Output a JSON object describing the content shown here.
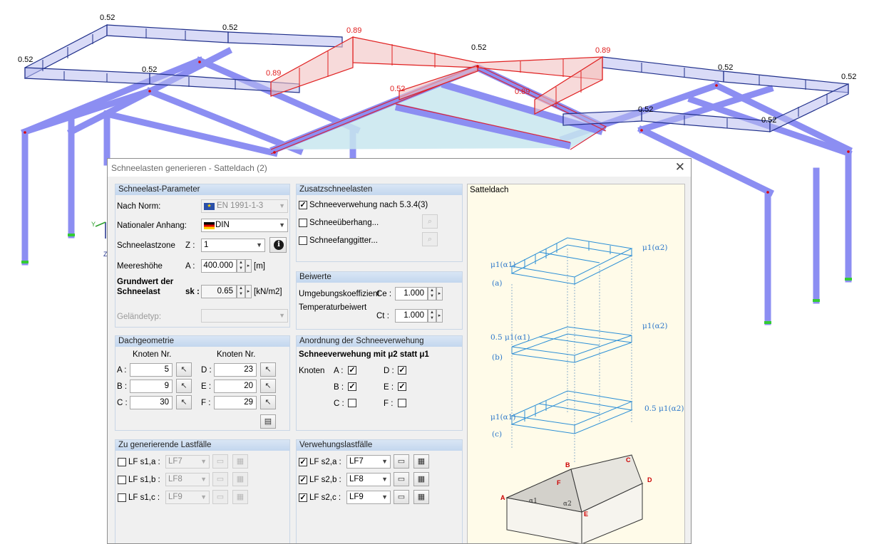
{
  "colors": {
    "member": "#8c8ef2",
    "load": "#1f2f8a",
    "drift_load": "#e02020",
    "diagram_blue": "#2b8fd6",
    "node_red": "#dd0000"
  },
  "structure": {
    "load_labels": [
      "0.52",
      "0.52",
      "0.52",
      "0.52",
      "0.89",
      "0.52",
      "0.89",
      "0.89",
      "0.52",
      "0.89",
      "0.52",
      "0.52",
      "0.52",
      "0.52"
    ],
    "axis_y": "Y",
    "axis_z": "Z"
  },
  "dialog": {
    "title": "Schneelasten generieren  -  Satteldach  (2)",
    "close_icon": "close-icon",
    "params": {
      "header": "Schneelast-Parameter",
      "norm_label": "Nach Norm:",
      "norm_value": "EN 1991-1-3",
      "annex_label": "Nationaler Anhang:",
      "annex_value": "DIN",
      "zone_label": "Schneelastzone",
      "zone_symbol": "Z :",
      "zone_value": "1",
      "altitude_label": "Meereshöhe",
      "altitude_symbol": "A :",
      "altitude_value": "400.000",
      "altitude_unit": "[m]",
      "base_label_1": "Grundwert der",
      "base_label_2": "Schneelast",
      "base_symbol": "sk :",
      "base_value": "0.65",
      "base_unit": "[kN/m2]",
      "terrain_label": "Geländetyp:"
    },
    "additional": {
      "header": "Zusatzschneelasten",
      "items": [
        {
          "label": "Schneeverwehung nach 5.3.4(3)",
          "checked": "✓"
        },
        {
          "label": "Schneeüberhang...",
          "checked": ""
        },
        {
          "label": "Schneefanggitter...",
          "checked": ""
        }
      ]
    },
    "coefficients": {
      "header": "Beiwerte",
      "ce_label": "Umgebungskoeffizient",
      "ce_symbol": "Ce :",
      "ce_value": "1.000",
      "ct_label": "Temperaturbeiwert",
      "ct_symbol": "Ct :",
      "ct_value": "1.000"
    },
    "geometry": {
      "header": "Dachgeometrie",
      "col_header_left": "Knoten Nr.",
      "col_header_right": "Knoten Nr.",
      "nodes": [
        {
          "label": "A :",
          "value": "5"
        },
        {
          "label": "B :",
          "value": "9"
        },
        {
          "label": "C :",
          "value": "30"
        },
        {
          "label": "D :",
          "value": "23"
        },
        {
          "label": "E :",
          "value": "20"
        },
        {
          "label": "F :",
          "value": "29"
        }
      ]
    },
    "drift_arrangement": {
      "header": "Anordnung der Schneeverwehung",
      "subtitle": "Schneeverwehung mit μ2 statt μ1",
      "nodes_label": "Knoten",
      "nodes": [
        {
          "label": "A :",
          "checked": "✓"
        },
        {
          "label": "B :",
          "checked": "✓"
        },
        {
          "label": "C :",
          "checked": ""
        },
        {
          "label": "D :",
          "checked": "✓"
        },
        {
          "label": "E :",
          "checked": "✓"
        },
        {
          "label": "F :",
          "checked": ""
        }
      ]
    },
    "loadcases": {
      "header": "Zu generierende Lastfälle",
      "rows": [
        {
          "label": "LF s1,a :",
          "value": "LF7",
          "checked": ""
        },
        {
          "label": "LF s1,b :",
          "value": "LF8",
          "checked": ""
        },
        {
          "label": "LF s1,c :",
          "value": "LF9",
          "checked": ""
        }
      ]
    },
    "drift_loadcases": {
      "header": "Verwehungslastfälle",
      "rows": [
        {
          "label": "LF s2,a :",
          "value": "LF7",
          "checked": "✓"
        },
        {
          "label": "LF s2,b :",
          "value": "LF8",
          "checked": "✓"
        },
        {
          "label": "LF s2,c :",
          "value": "LF9",
          "checked": "✓"
        }
      ]
    },
    "preview": {
      "title": "Satteldach",
      "labels": {
        "a_left": "μ1(α1)",
        "a_right": "μ1(α2)",
        "a_tag": "(a)",
        "b_left": "0.5 μ1(α1)",
        "b_right": "μ1(α2)",
        "b_tag": "(b)",
        "c_left": "μ1(α1)",
        "c_right": "0.5 μ1(α2)",
        "c_tag": "(c)",
        "alpha1": "α1",
        "alpha2": "α2",
        "node_a": "A",
        "node_b": "B",
        "node_c": "C",
        "node_d": "D",
        "node_e": "E",
        "node_f": "F"
      }
    }
  }
}
